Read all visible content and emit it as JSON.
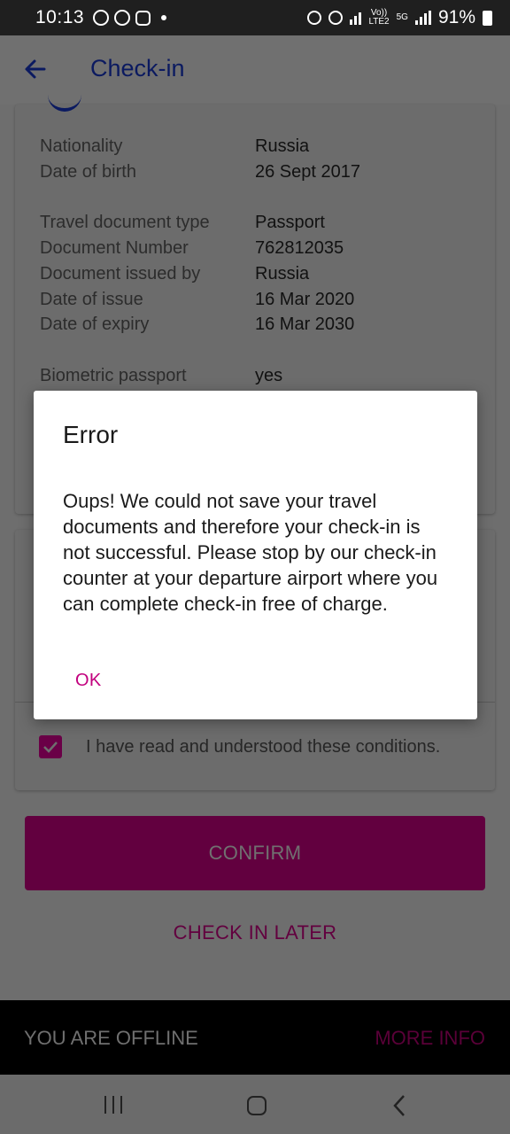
{
  "status_bar": {
    "time": "10:13",
    "battery": "91%",
    "net_top": "Vo))",
    "net_bottom": "LTE2",
    "five_g": "5G"
  },
  "app_bar": {
    "title": "Check-in"
  },
  "details": [
    {
      "label": "Nationality",
      "value": "Russia"
    },
    {
      "label": "Date of birth",
      "value": "26 Sept 2017"
    },
    {
      "label": "Travel document type",
      "value": "Passport"
    },
    {
      "label": "Document Number",
      "value": "762812035"
    },
    {
      "label": "Document issued by",
      "value": "Russia"
    },
    {
      "label": "Date of issue",
      "value": "16 Mar 2020"
    },
    {
      "label": "Date of expiry",
      "value": "16 Mar 2030"
    },
    {
      "label": "Biometric passport",
      "value": "yes"
    }
  ],
  "conditions": {
    "checkbox_label": "I have read and understood these conditions.",
    "checked": true
  },
  "buttons": {
    "confirm": "CONFIRM",
    "check_in_later": "CHECK IN LATER"
  },
  "offline_bar": {
    "text": "YOU ARE OFFLINE",
    "more_info": "MORE INFO"
  },
  "dialog": {
    "title": "Error",
    "message": "Oups! We could not save your travel documents and therefore your check-in is not successful. Please stop by our check-in counter at your departure airport where you can complete check-in free of charge.",
    "ok": "OK"
  },
  "colors": {
    "brand_navy": "#0b1a60",
    "brand_magenta": "#c2007e",
    "scrim": "#6e6e6e"
  }
}
